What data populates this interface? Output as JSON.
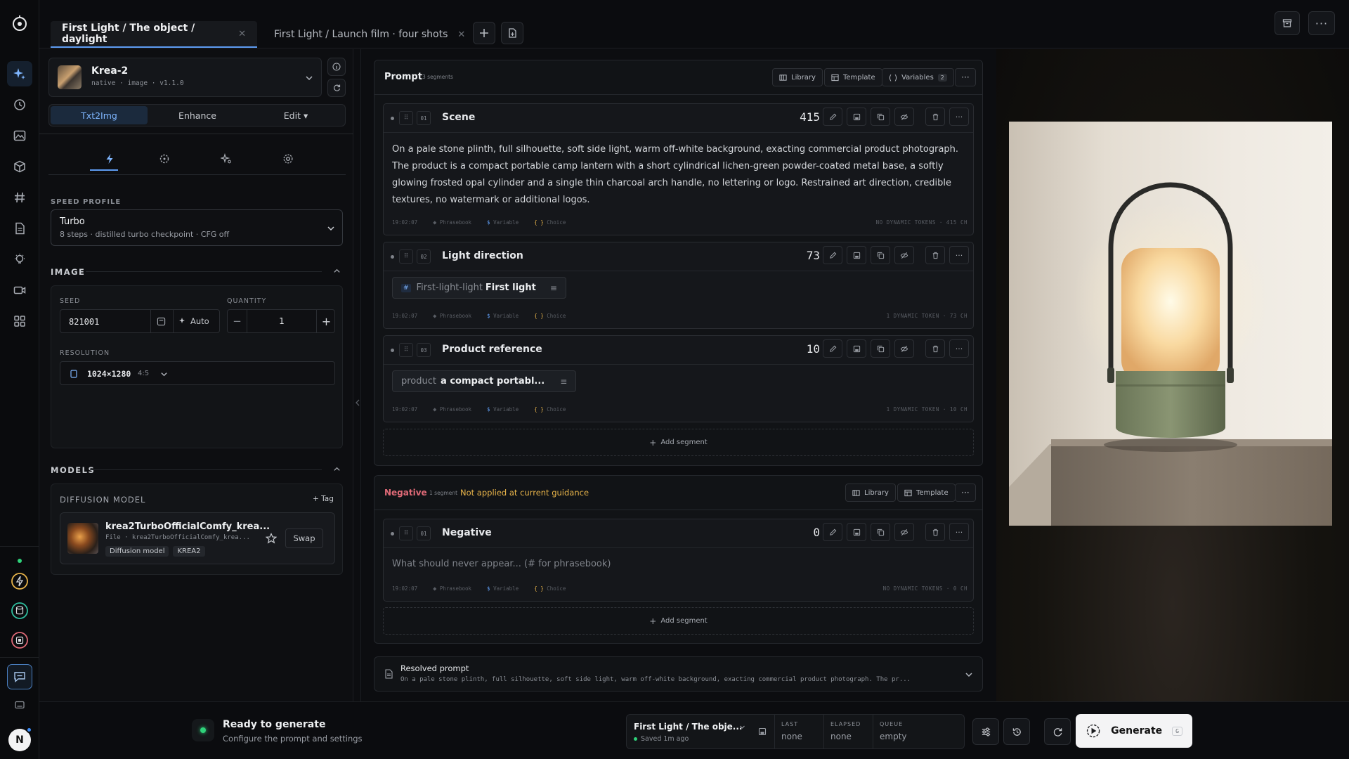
{
  "tabs": [
    {
      "label": "First Light / The object / daylight",
      "active": true
    },
    {
      "label": "First Light / Launch film · four shots",
      "active": false
    }
  ],
  "model": {
    "name": "Krea-2",
    "meta": "native · image · v1.1.0"
  },
  "modes": [
    "Txt2Img",
    "Enhance",
    "Edit ▾"
  ],
  "speed_profile": {
    "label": "SPEED PROFILE",
    "name": "Turbo",
    "desc": "8 steps · distilled turbo checkpoint · CFG off"
  },
  "image": {
    "section": "IMAGE",
    "seed_label": "SEED",
    "seed": "821001",
    "auto": "Auto",
    "qty_label": "QUANTITY",
    "qty": "1",
    "res_label": "RESOLUTION",
    "resolution": "1024×1280",
    "ratio": "4:5"
  },
  "models": {
    "section": "MODELS",
    "diffusion_label": "DIFFUSION MODEL",
    "tag_btn": "+ Tag",
    "name": "krea2TurboOfficialComfy_krea...",
    "file": "File · krea2TurboOfficialComfy_krea...",
    "badges": [
      "Diffusion model",
      "KREA2"
    ],
    "swap": "Swap"
  },
  "prompt": {
    "title": "Prompt",
    "count": "3 segments",
    "library": "Library",
    "template": "Template",
    "variables": "Variables",
    "variables_count": "2",
    "segments": [
      {
        "num": "01",
        "title": "Scene",
        "count": "415",
        "text": "On a pale stone plinth, full silhouette, soft side light, warm off-white background, exacting commercial product photograph. The product is a compact portable camp lantern with a short cylindrical lichen-green powder-coated metal base, a softly glowing frosted opal cylinder and a single thin charcoal arch handle, no lettering or logo. Restrained art direction, credible textures, no watermark or additional logos.",
        "stamp": "19:02:07",
        "foot_right": "NO DYNAMIC TOKENS · 415 CH"
      },
      {
        "num": "02",
        "title": "Light direction",
        "count": "73",
        "token_key": "First-light-light",
        "token_val": "First light",
        "stamp": "19:02:07",
        "foot_right": "1 DYNAMIC TOKEN · 73 CH"
      },
      {
        "num": "03",
        "title": "Product reference",
        "count": "10",
        "token_key": "product",
        "token_val": "a compact portabl...",
        "stamp": "19:02:07",
        "foot_right": "1 DYNAMIC TOKEN · 10 CH"
      }
    ],
    "add_segment": "Add segment"
  },
  "foot_labels": [
    "Phrasebook",
    "Variable",
    "Choice"
  ],
  "negative": {
    "title": "Negative",
    "count": "1 segment",
    "warning": "Not applied at current guidance",
    "library": "Library",
    "template": "Template",
    "segment": {
      "num": "01",
      "title": "Negative",
      "count": "0",
      "placeholder": "What should never appear... (# for phrasebook)",
      "stamp": "19:02:07",
      "foot_right": "NO DYNAMIC TOKENS · 0 CH"
    },
    "add_segment": "Add segment"
  },
  "resolved": {
    "title": "Resolved prompt",
    "text": "On a pale stone plinth, full silhouette, soft side light, warm off-white background, exacting commercial product photograph. The pr..."
  },
  "status": {
    "title": "Ready to generate",
    "sub": "Configure the prompt and settings"
  },
  "job": {
    "name": "First Light / The obje...",
    "saved": "Saved 1m ago",
    "last_label": "LAST",
    "last": "none",
    "elapsed_label": "ELAPSED",
    "elapsed": "none",
    "queue_label": "QUEUE",
    "queue": "empty"
  },
  "generate": {
    "label": "Generate",
    "badge": "G"
  },
  "user": {
    "initial": "N"
  },
  "colors": {
    "accent": "#5e9cf2",
    "warning": "#e8b44a",
    "negative": "#e06a77",
    "ready": "#2fd27a"
  }
}
